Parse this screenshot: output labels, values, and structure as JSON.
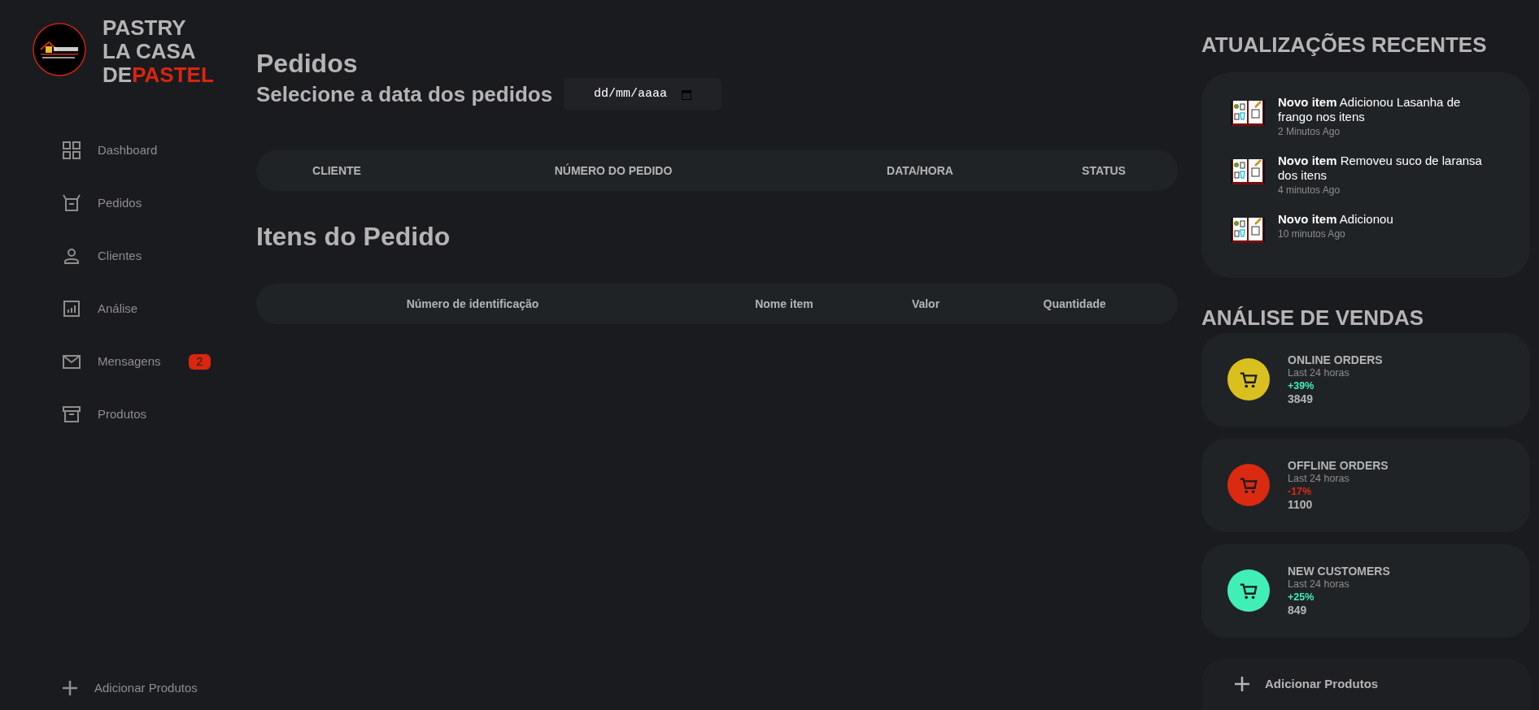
{
  "brand": {
    "lines": [
      "PASTRY",
      "LA CASA"
    ],
    "last_plain": "DE",
    "last_accent": "PASTEL"
  },
  "sidebar": {
    "items": [
      {
        "label": "Dashboard"
      },
      {
        "label": "Pedidos"
      },
      {
        "label": "Clientes"
      },
      {
        "label": "Análise"
      },
      {
        "label": "Mensagens",
        "badge": "2"
      },
      {
        "label": "Produtos"
      }
    ],
    "footer": {
      "label": "Adicionar Produtos"
    }
  },
  "orders": {
    "title": "Pedidos",
    "date_label": "Selecione a data dos pedidos",
    "date_field": {
      "placeholder": "dd/mm/aaaa"
    },
    "columns": [
      "CLIENTE",
      "NÚMERO DO PEDIDO",
      "DATA/HORA",
      "STATUS"
    ]
  },
  "items": {
    "title": "Itens do Pedido",
    "columns": [
      "Número de identificação",
      "Nome item",
      "Valor",
      "Quantidade"
    ]
  },
  "updates": {
    "title": "ATUALIZAÇÕES RECENTES",
    "items": [
      {
        "text": "**Novo item** Adicionou Lasanha de frango nos itens",
        "time": "2 Minutos Ago"
      },
      {
        "text": "**Novo item** Removeu suco de laransa dos itens",
        "time": "4 minutos Ago"
      },
      {
        "text": "**Novo item** Adicionou",
        "time": "10 minutos Ago"
      }
    ]
  },
  "sales": {
    "title": "ANÁLISE DE VENDAS",
    "cards": [
      {
        "title": "ONLINE ORDERS",
        "period": "Last 24 horas",
        "change": {
          "text": "+39%",
          "color": "#41efb6"
        },
        "value": "3849",
        "color": "#d9c01e"
      },
      {
        "title": "OFFLINE ORDERS",
        "period": "Last 24 horas",
        "change": {
          "text": "-17%",
          "color": "#db2a12"
        },
        "value": "1100",
        "color": "#db2a12"
      },
      {
        "title": "NEW CUSTOMERS",
        "period": "Last 24 horas",
        "change": {
          "text": "+25%",
          "color": "#41efb6"
        },
        "value": "849",
        "color": "#41efb6"
      }
    ],
    "add_button": {
      "label": "Adicionar Produtos"
    }
  }
}
